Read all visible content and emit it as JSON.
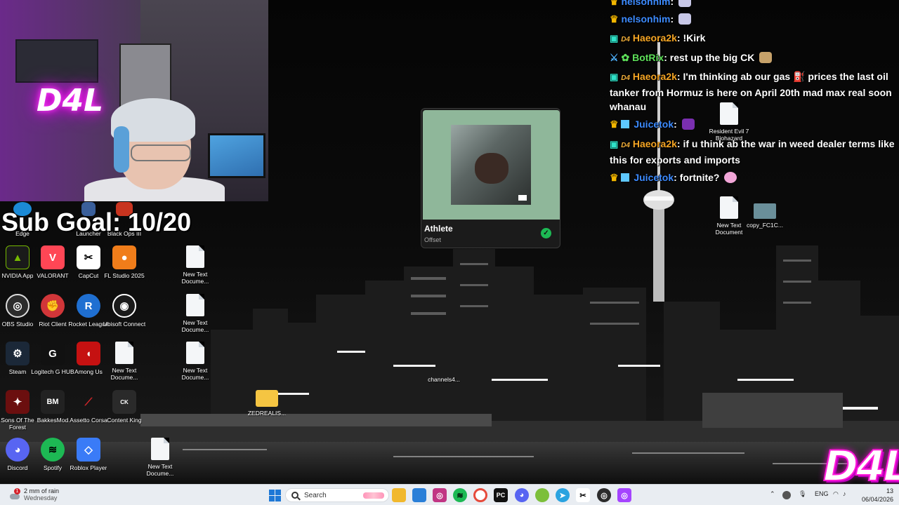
{
  "sub_goal": "Sub Goal: 10/20",
  "webcam": {
    "neon_sign": "D4L"
  },
  "logo": "D4L",
  "desktop_icons": {
    "partial_row": [
      "Edge",
      "Launcher",
      "Black Ops III"
    ],
    "nvidia": "NVIDIA App",
    "valorant": "VALORANT",
    "capcut": "CapCut",
    "fl_studio": "FL Studio 2025",
    "new_text_1": "New Text Docume...",
    "obs": "OBS Studio",
    "riot": "Riot Client",
    "rocket": "Rocket League",
    "ubisoft": "Ubisoft Connect",
    "new_text_2": "New Text Docume...",
    "steam": "Steam",
    "logitech": "Logitech G HUB",
    "among_us": "Among Us",
    "new_text_3": "New Text Docume...",
    "new_text_4": "New Text Docume...",
    "channels": "channels4...",
    "sons_forest": "Sons Of The Forest",
    "bakkes": "BakkesMod",
    "assetto": "Assetto Corsa",
    "content_king": "Content King",
    "zedrealis": "ZEDREALIS...",
    "discord": "Discord",
    "spotify": "Spotify",
    "roblox": "Roblox Player",
    "new_text_5": "New Text Docume...",
    "resident_evil": "Resident Evil 7 Biohazard",
    "new_text_6": "New Text Document",
    "copy_fc": "copy_FC1C..."
  },
  "now_playing": {
    "title": "Athlete",
    "artist": "Offset",
    "accent": "#8fb79a"
  },
  "chat": [
    {
      "user": "nelsonhim",
      "color": "#3d8bff",
      "badge": "crown",
      "text": ""
    },
    {
      "user": "nelsonhim",
      "color": "#3d8bff",
      "badge": "crown",
      "text": ""
    },
    {
      "user": "Haeora2k",
      "color": "#f5a524",
      "badge": "d4",
      "text": "!Kirk"
    },
    {
      "user": "BotRix",
      "color": "#5ee05a",
      "badge": "sword",
      "text": "rest up the big CK"
    },
    {
      "user": "Haeora2k",
      "color": "#f5a524",
      "badge": "d4",
      "text": "I'm thinking ab our gas ⛽ prices the last oil tanker from Hormuz is here on April 20th mad max real soon whanau"
    },
    {
      "user": "Juicetok",
      "color": "#3d8bff",
      "badge": "crown",
      "text": ""
    },
    {
      "user": "Haeora2k",
      "color": "#f5a524",
      "badge": "d4",
      "text": "if u think ab the war in weed dealer terms like this for exports and imports"
    },
    {
      "user": "Juicetok",
      "color": "#3d8bff",
      "badge": "crown",
      "text": "fortnite?"
    }
  ],
  "taskbar": {
    "weather_title": "2 mm of rain",
    "weather_sub": "Wednesday",
    "weather_alert": "1",
    "search_placeholder": "Search",
    "lang": "ENG",
    "time": "13",
    "date": "06/04/2026"
  }
}
